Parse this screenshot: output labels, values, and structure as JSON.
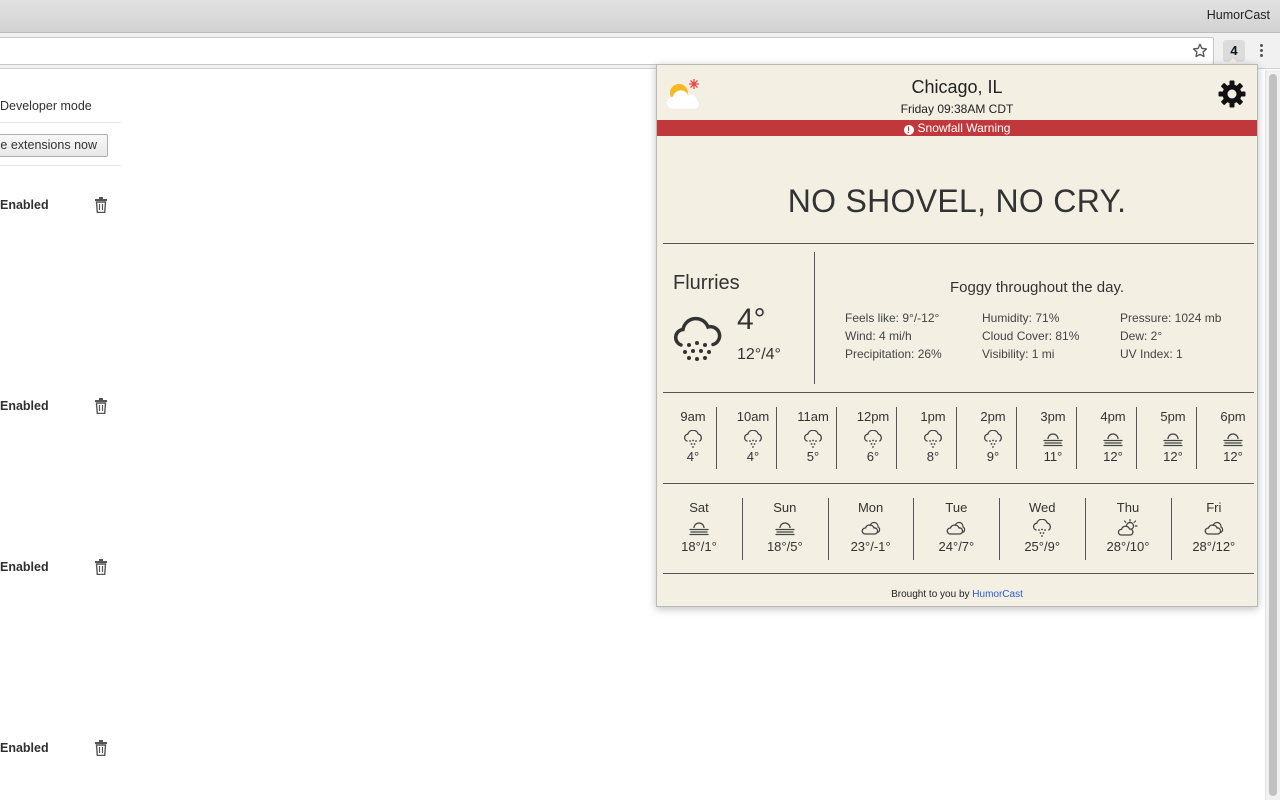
{
  "window": {
    "app_title": "HumorCast",
    "extension_badge": "4"
  },
  "ext_page": {
    "developer_mode_label": "Developer mode",
    "update_button_label": "e extensions now",
    "rows": [
      {
        "status": "Enabled"
      },
      {
        "status": "Enabled"
      },
      {
        "status": "Enabled"
      },
      {
        "status": "Enabled"
      }
    ]
  },
  "popup": {
    "city": "Chicago, IL",
    "datetime": "Friday 09:38AM CDT",
    "alert": "Snowfall Warning",
    "headline": "NO SHOVEL, NO CRY.",
    "current": {
      "condition": "Flurries",
      "temp": "4°",
      "hilo": "12°/4°",
      "summary": "Foggy throughout the day.",
      "feels_like": "Feels like: 9°/-12°",
      "wind": "Wind: 4 mi/h",
      "precipitation": "Precipitation: 26%",
      "humidity": "Humidity: 71%",
      "cloud_cover": "Cloud Cover: 81%",
      "visibility": "Visibility: 1 mi",
      "pressure": "Pressure: 1024 mb",
      "dew": "Dew: 2°",
      "uv_index": "UV Index: 1"
    },
    "hourly": [
      {
        "time": "9am",
        "icon": "snow-icon",
        "temp": "4°"
      },
      {
        "time": "10am",
        "icon": "snow-icon",
        "temp": "4°"
      },
      {
        "time": "11am",
        "icon": "snow-icon",
        "temp": "5°"
      },
      {
        "time": "12pm",
        "icon": "snow-icon",
        "temp": "6°"
      },
      {
        "time": "1pm",
        "icon": "snow-icon",
        "temp": "8°"
      },
      {
        "time": "2pm",
        "icon": "snow-icon",
        "temp": "9°"
      },
      {
        "time": "3pm",
        "icon": "fog-icon",
        "temp": "11°"
      },
      {
        "time": "4pm",
        "icon": "fog-icon",
        "temp": "12°"
      },
      {
        "time": "5pm",
        "icon": "fog-icon",
        "temp": "12°"
      },
      {
        "time": "6pm",
        "icon": "fog-icon",
        "temp": "12°"
      }
    ],
    "daily": [
      {
        "day": "Sat",
        "icon": "fog-icon",
        "temp": "18°/1°"
      },
      {
        "day": "Sun",
        "icon": "fog-icon",
        "temp": "18°/5°"
      },
      {
        "day": "Mon",
        "icon": "cloudy-icon",
        "temp": "23°/-1°"
      },
      {
        "day": "Tue",
        "icon": "cloudy-icon",
        "temp": "24°/7°"
      },
      {
        "day": "Wed",
        "icon": "snow-icon",
        "temp": "25°/9°"
      },
      {
        "day": "Thu",
        "icon": "partly-sunny-icon",
        "temp": "28°/10°"
      },
      {
        "day": "Fri",
        "icon": "cloudy-icon",
        "temp": "28°/12°"
      }
    ],
    "footer_text": "Brought to you by",
    "footer_link": "HumorCast"
  },
  "colors": {
    "popup_bg": "#f3efe2",
    "alert_bg": "#c0383b",
    "link": "#2a5bd7"
  }
}
